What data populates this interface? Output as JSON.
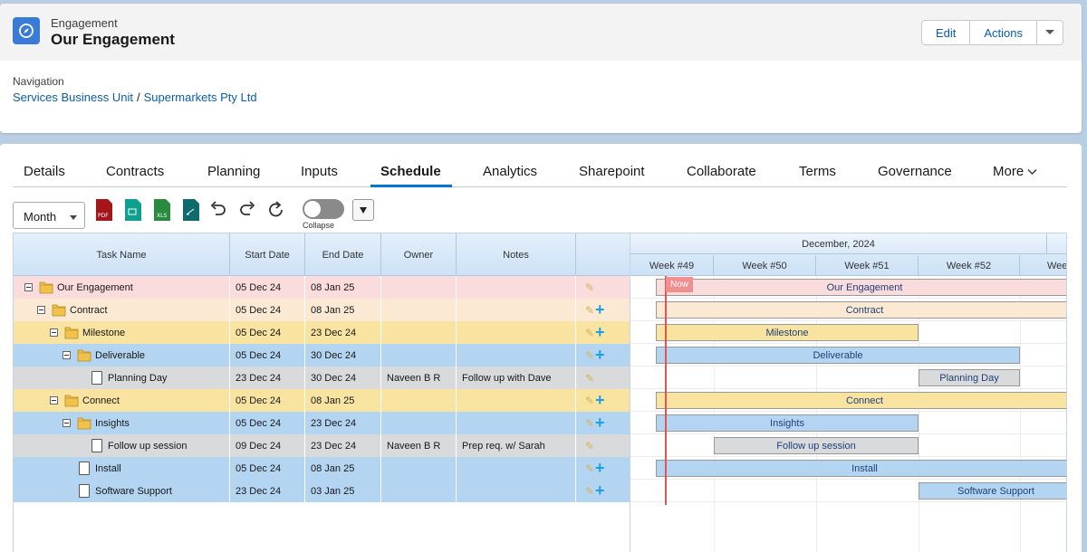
{
  "header": {
    "object_type": "Engagement",
    "record_name": "Our Engagement",
    "buttons": {
      "edit": "Edit",
      "actions": "Actions"
    },
    "navigation_label": "Navigation",
    "breadcrumb": [
      "Services Business Unit",
      "Supermarkets Pty Ltd"
    ],
    "breadcrumb_sep": "/"
  },
  "tabs": [
    "Details",
    "Contracts",
    "Planning",
    "Inputs",
    "Schedule",
    "Analytics",
    "Sharepoint",
    "Collaborate",
    "Terms",
    "Governance",
    "More"
  ],
  "active_tab": "Schedule",
  "toolbar": {
    "view_select": "Month",
    "export_icons": [
      "pdf-icon",
      "image-icon",
      "xls-icon",
      "doc-export-icon"
    ],
    "collapse_label": "Collapse",
    "collapse_on": false
  },
  "grid": {
    "columns": [
      "Task Name",
      "Start Date",
      "End Date",
      "Owner",
      "Notes",
      ""
    ],
    "month": "December, 2024",
    "weeks": [
      "Week #49",
      "Week #50",
      "Week #51",
      "Week #52",
      "Wee"
    ],
    "now_label": "Now",
    "rows": [
      {
        "name": "Our Engagement",
        "start": "05 Dec 24",
        "end": "08 Jan 25",
        "owner": "",
        "notes": "",
        "type": "folder",
        "level": 0
      },
      {
        "name": "Contract",
        "start": "05 Dec 24",
        "end": "08 Jan 25",
        "owner": "",
        "notes": "",
        "type": "folder",
        "level": 1
      },
      {
        "name": "Milestone",
        "start": "05 Dec 24",
        "end": "23 Dec 24",
        "owner": "",
        "notes": "",
        "type": "folder",
        "level": 2
      },
      {
        "name": "Deliverable",
        "start": "05 Dec 24",
        "end": "30 Dec 24",
        "owner": "",
        "notes": "",
        "type": "folder",
        "level": 3
      },
      {
        "name": "Planning Day",
        "start": "23 Dec 24",
        "end": "30 Dec 24",
        "owner": "Naveen B R",
        "notes": "Follow up with Dave",
        "type": "task",
        "level": 4
      },
      {
        "name": "Connect",
        "start": "05 Dec 24",
        "end": "08 Jan 25",
        "owner": "",
        "notes": "",
        "type": "folder",
        "level": 2
      },
      {
        "name": "Insights",
        "start": "05 Dec 24",
        "end": "23 Dec 24",
        "owner": "",
        "notes": "",
        "type": "folder",
        "level": 3
      },
      {
        "name": "Follow up session",
        "start": "09 Dec 24",
        "end": "23 Dec 24",
        "owner": "Naveen B R",
        "notes": "Prep req. w/ Sarah",
        "type": "task",
        "level": 4
      },
      {
        "name": "Install",
        "start": "05 Dec 24",
        "end": "08 Jan 25",
        "owner": "",
        "notes": "",
        "type": "task",
        "level": 3
      },
      {
        "name": "Software Support",
        "start": "23 Dec 24",
        "end": "03 Jan 25",
        "owner": "",
        "notes": "",
        "type": "task",
        "level": 3
      }
    ]
  },
  "colors": {
    "pink": "#fbdcdc",
    "peach": "#fbe9d3",
    "yellow": "#f8e3a1",
    "blue": "#b4d5f1",
    "gray": "#d8dadb",
    "accent": "#0176d3",
    "now": "#e45252"
  }
}
